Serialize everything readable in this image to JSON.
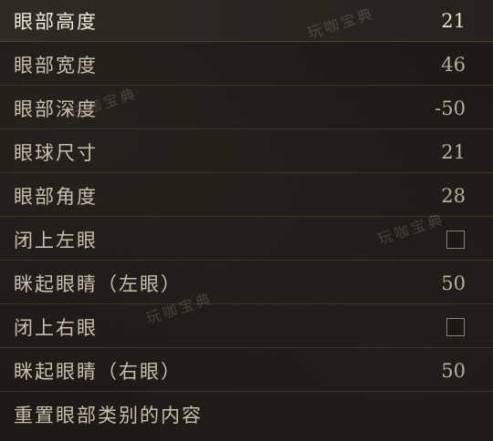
{
  "settings": [
    {
      "label": "眼部高度",
      "value": "21"
    },
    {
      "label": "眼部宽度",
      "value": "46"
    },
    {
      "label": "眼部深度",
      "value": "-50"
    },
    {
      "label": "眼球尺寸",
      "value": "21"
    },
    {
      "label": "眼部角度",
      "value": "28"
    },
    {
      "label": "闭上左眼",
      "checked": false
    },
    {
      "label": "眯起眼睛（左眼）",
      "value": "50"
    },
    {
      "label": "闭上右眼",
      "checked": false
    },
    {
      "label": "眯起眼睛（右眼）",
      "value": "50"
    },
    {
      "label": "重置眼部类别的内容"
    }
  ],
  "watermark": "玩咖宝典"
}
